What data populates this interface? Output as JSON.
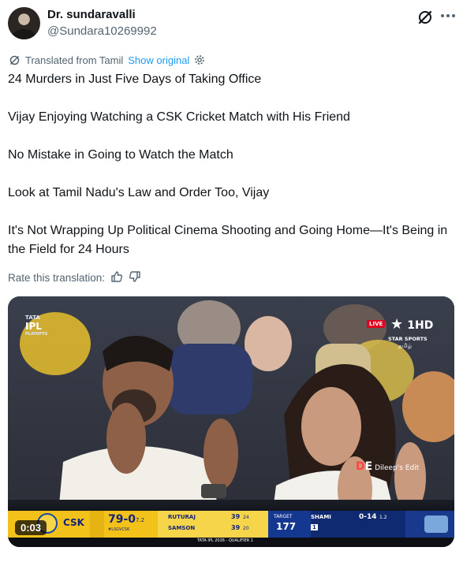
{
  "author": {
    "name": "Dr. sundaravalli",
    "handle": "@Sundara10269992"
  },
  "translation": {
    "label": "Translated from Tamil",
    "show_original": "Show original",
    "rate_label": "Rate this translation:"
  },
  "tweet": {
    "paragraphs": [
      "24 Murders in Just Five Days of Taking Office",
      "Vijay Enjoying Watching a CSK Cricket Match with His Friend",
      "No Mistake in Going to Watch the Match",
      "Look at Tamil Nadu's Law and Order Too, Vijay",
      "It's Not Wrapping Up Political Cinema Shooting and Going Home—It's Being in the Field for 24 Hours"
    ]
  },
  "media": {
    "timestamp": "0:03",
    "ipl_logo": {
      "line1": "TATA",
      "line2": "IPL",
      "line3": "PLAYOFFS"
    },
    "broadcaster": {
      "live": "LIVE",
      "channel": "1HD",
      "name": "STAR SPORTS",
      "sub": "தமிழ்"
    },
    "watermark": "Dileep's Edit",
    "scoreboard": {
      "team": "CSK",
      "score": "79-0",
      "overs": "7.2",
      "match": "#LSGVCSK",
      "batter1": {
        "name": "RUTURAJ",
        "runs": "39",
        "balls": "24"
      },
      "batter2": {
        "name": "SAMSON",
        "runs": "39",
        "balls": "20"
      },
      "target_label": "TARGET",
      "target": "177",
      "bowler": {
        "name": "SHAMI",
        "figures": "0-14",
        "overs": "1.2",
        "over_balls": "1"
      },
      "footer": "TATA IPL 2026 - QUALIFIER 1"
    }
  },
  "colors": {
    "link": "#1d9bf0",
    "secondary_text": "#536471",
    "scoreboard_yellow": "#f2c21b",
    "scoreboard_blue": "#14388f"
  }
}
